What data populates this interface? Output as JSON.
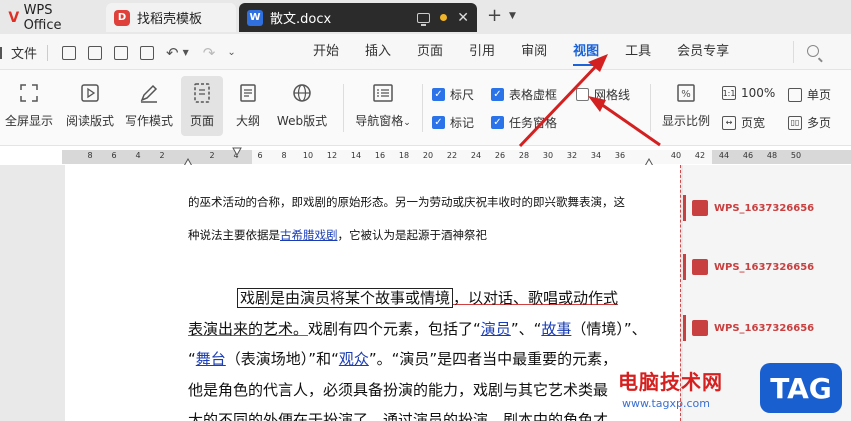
{
  "tabs": {
    "wps": "WPS Office",
    "template": "找稻壳模板",
    "doc": "散文.docx"
  },
  "menubar": {
    "file": "文件",
    "items": [
      "开始",
      "插入",
      "页面",
      "引用",
      "审阅",
      "视图",
      "工具",
      "会员专享"
    ],
    "active": "视图"
  },
  "toolbar": {
    "buttons": [
      "全屏显示",
      "阅读版式",
      "写作模式",
      "页面",
      "大纲",
      "Web版式",
      "导航窗格"
    ],
    "checkboxes": [
      {
        "label": "标尺",
        "checked": true
      },
      {
        "label": "表格虚框",
        "checked": true
      },
      {
        "label": "网格线",
        "checked": false
      },
      {
        "label": "标记",
        "checked": true
      },
      {
        "label": "任务窗格",
        "checked": true
      }
    ],
    "zoom_label": "显示比例",
    "zoom_100": "100%",
    "page_width": "页宽",
    "single_page": "单页",
    "multi_page": "多页"
  },
  "ruler": {
    "numbers": [
      "8",
      "6",
      "4",
      "2",
      "2",
      "4",
      "6",
      "8",
      "10",
      "12",
      "14",
      "16",
      "18",
      "20",
      "22",
      "24",
      "26",
      "28",
      "30",
      "32",
      "34",
      "36",
      "40",
      "42",
      "44",
      "46",
      "48",
      "50"
    ]
  },
  "document": {
    "line1": "的巫术活动的合称，即戏剧的原始形态。另一为劳动或庆祝丰收时的即兴歌舞表演，这",
    "line2_pre": "种说法主要依据是",
    "line2_link": "古希腊戏剧",
    "line2_post": "，它被认为是起源于酒神祭祀",
    "p_box": "戏剧是由演员将某个故事或情境",
    "p_l1_rest": "，以对话、歌唱或动作式",
    "p_l2_a": "表演出来的艺术。",
    "p_l2_b": "戏剧有四个元素，包括了“",
    "p_l2_l1": "演员",
    "p_l2_c": "”、“",
    "p_l2_l2": "故事",
    "p_l2_d": "（情境）”、",
    "p_l3_a": "“",
    "p_l3_l1": "舞台",
    "p_l3_b": "（表演场地）”和“",
    "p_l3_l2": "观众",
    "p_l3_c": "”。“演员”是四者当中最重要的元素，",
    "p_l4": "他是角色的代言人，必须具备扮演的能力，戏剧与其它艺术类最",
    "p_l5": "大的不同的外便在于扮演了，通过演员的扮演，剧本中的角色才"
  },
  "comments": [
    "WPS_1637326656",
    "WPS_1637326656",
    "WPS_1637326656"
  ],
  "watermark": {
    "title": "电脑技术网",
    "url": "www.tagxp.com",
    "logo": "TAG"
  }
}
